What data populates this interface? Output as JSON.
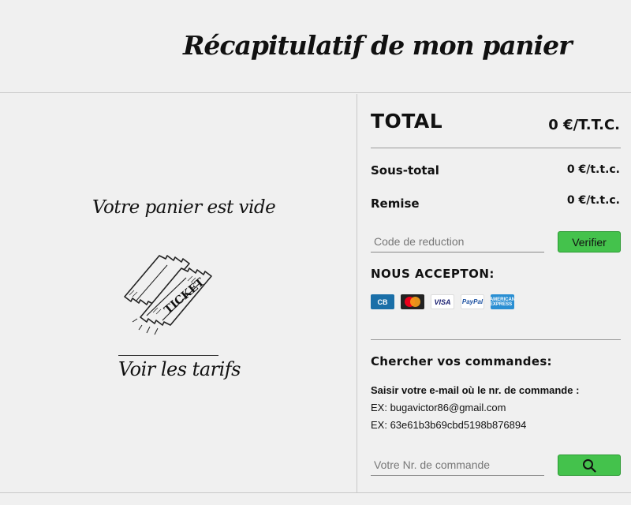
{
  "header": {
    "title": "Récapitulatif de mon panier"
  },
  "cart": {
    "empty_message": "Votre panier est vide",
    "link_label": "Voir les tarifs"
  },
  "summary": {
    "total_label": "TOTAL",
    "total_value": "0 €/T.T.C.",
    "subtotal_label": "Sous-total",
    "subtotal_value": "0 €/t.t.c.",
    "discount_label": "Remise",
    "discount_value": "0 €/t.t.c.",
    "promo_placeholder": "Code de reduction",
    "verify_label": "Verifier",
    "accept_label": "NOUS ACCEPTON:",
    "cards": [
      {
        "name": "cb-card-icon",
        "text": "CB"
      },
      {
        "name": "mastercard-icon",
        "text": ""
      },
      {
        "name": "visa-card-icon",
        "text": "VISA"
      },
      {
        "name": "paypal-icon",
        "text": "PayPal"
      },
      {
        "name": "amex-card-icon",
        "text": "AMERICAN EXPRESS"
      }
    ]
  },
  "orders": {
    "title": "Chercher vos commandes:",
    "instruction": "Saisir votre e-mail où le nr. de commande :",
    "example_email": "EX: bugavictor86@gmail.com",
    "example_order": "EX: 63e61b3b69cbd5198b876894",
    "search_placeholder": "Votre Nr. de commande"
  },
  "colors": {
    "accent_green": "#44c24c",
    "background": "#f0f0f0"
  }
}
